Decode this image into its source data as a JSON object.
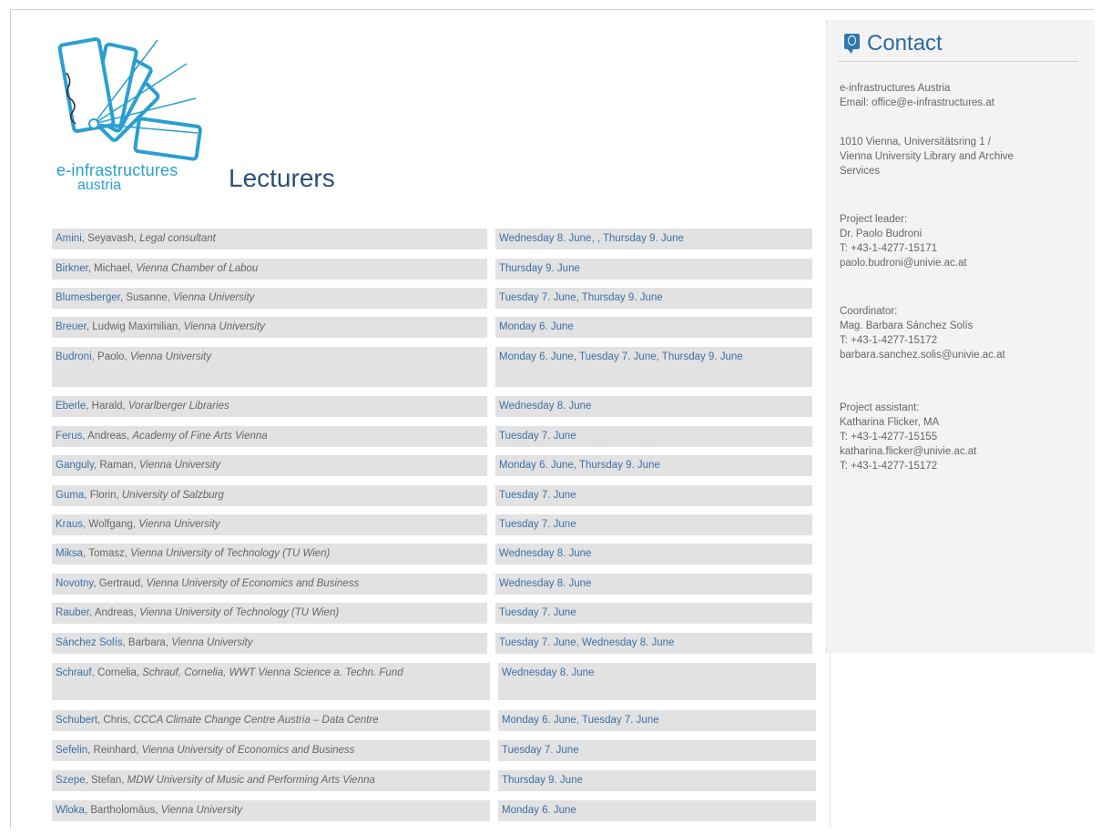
{
  "brand": {
    "logo_line1": "e-infrastructures",
    "logo_line2": "austria"
  },
  "page_title": "Lecturers",
  "contact": {
    "title": "Contact",
    "org": "e-infrastructures Austria",
    "email_line": "Email: office@e-infrastructures.at",
    "address_line1": "1010 Vienna, Universitätsring 1 /",
    "address_line2": "Vienna University Library and Archive",
    "address_line3": "Services",
    "leader_label": "Project leader:",
    "leader_name": "Dr. Paolo Budroni",
    "leader_phone": "T: +43-1-4277-15171",
    "leader_email": "paolo.budroni@univie.ac.at",
    "coord_label": "Coordinator:",
    "coord_name": "Mag. Barbara Sánchez Solís",
    "coord_phone": "T: +43-1-4277-15172",
    "coord_email": "barbara.sanchez.solis@univie.ac.at",
    "assist_label": "Project assistant:",
    "assist_name": "Katharina Flicker, MA",
    "assist_phone": "T: +43-1-4277-15155",
    "assist_email": "katharina.flicker@univie.ac.at",
    "assist_phone2": "T: +43-1-4277-15172"
  },
  "lecturers": [
    {
      "surname": "Amini",
      "first": ", Seyavash, ",
      "affiliation": "Legal consultant",
      "dates": "Wednesday 8. June, , Thursday 9. June"
    },
    {
      "surname": "Birkner",
      "first": ", Michael, ",
      "affiliation": "Vienna Chamber of Labou",
      "dates": "Thursday 9. June"
    },
    {
      "surname": "Blumesberger",
      "first": ", Susanne, ",
      "affiliation": "Vienna University",
      "dates": "Tuesday 7. June, Thursday 9. June"
    },
    {
      "surname": "Breuer",
      "first": ", Ludwig Maximilian, ",
      "affiliation": "Vienna University",
      "dates": "Monday 6. June"
    },
    {
      "surname": "Budroni",
      "first": ", Paolo, ",
      "affiliation": "Vienna University",
      "dates": "Monday 6. June, Tuesday 7. June, Thursday 9. June"
    },
    {
      "surname": "Eberle",
      "first": ", Harald, ",
      "affiliation": "Vorarlberger Libraries",
      "dates": "Wednesday 8. June"
    },
    {
      "surname": "Ferus",
      "first": ", Andreas, ",
      "affiliation": "Academy of Fine Arts Vienna",
      "dates": "Tuesday 7. June"
    },
    {
      "surname": "Ganguly",
      "first": ", Raman, ",
      "affiliation": "Vienna University",
      "dates": "Monday 6. June, Thursday 9. June"
    },
    {
      "surname": "Guma",
      "first": ", Florin, ",
      "affiliation": "University of Salzburg",
      "dates": "Tuesday 7. June"
    },
    {
      "surname": "Kraus",
      "first": ", Wolfgang, ",
      "affiliation": "Vienna University",
      "dates": "Tuesday 7. June"
    },
    {
      "surname": "Miksa",
      "first": ", Tomasz, ",
      "affiliation": "Vienna University of Technology (TU Wien)",
      "dates": "Wednesday 8. June"
    },
    {
      "surname": "Novotny",
      "first": ", Gertraud, ",
      "affiliation": "Vienna University of Economics and Business",
      "dates": "Wednesday 8. June"
    },
    {
      "surname": "Rauber",
      "first": ", Andreas, ",
      "affiliation": "Vienna University of Technology (TU Wien)",
      "dates": "Tuesday 7. June"
    },
    {
      "surname": "Sánchez Solís",
      "first": ", Barbara, ",
      "affiliation": "Vienna University",
      "dates": "Tuesday 7. June, Wednesday 8. June"
    },
    {
      "surname": "Schrauf",
      "first": ", Cornelia, ",
      "affiliation": "Schrauf, Cornelia, WWT Vienna Science a. Techn. Fund",
      "dates": "Wednesday 8. June"
    },
    {
      "surname": "Schubert",
      "first": ", Chris, ",
      "affiliation": "CCCA Climate Change Centre Austria – Data Centre",
      "dates": "Monday 6. June, Tuesday 7. June"
    },
    {
      "surname": "Sefelin",
      "first": ", Reinhard, ",
      "affiliation": "Vienna University of Economics and Business",
      "dates": "Tuesday 7. June"
    },
    {
      "surname": "Szepe",
      "first": ", Stefan, ",
      "affiliation": "MDW University of Music and Performing Arts Vienna",
      "dates": "Thursday 9. June"
    },
    {
      "surname": "Wloka",
      "first": ", Bartholomäus, ",
      "affiliation": "Vienna University",
      "dates": "Monday 6. June"
    }
  ]
}
